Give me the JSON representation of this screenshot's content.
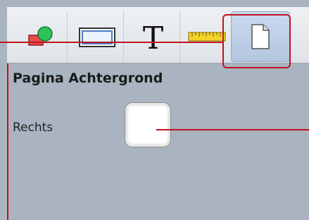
{
  "toolbar": {
    "buttons": [
      {
        "name": "shapes",
        "icon": "shapes-icon"
      },
      {
        "name": "rectangle",
        "icon": "rectangle-icon"
      },
      {
        "name": "text",
        "icon": "text-icon",
        "glyph": "T"
      },
      {
        "name": "ruler",
        "icon": "ruler-icon"
      },
      {
        "name": "page",
        "icon": "page-icon",
        "selected": true
      }
    ]
  },
  "panel": {
    "title": "Pagina Achtergrond",
    "rows": [
      {
        "label": "Rechts",
        "swatch_color": "#ffffff"
      }
    ]
  },
  "colors": {
    "callout": "#c1121f",
    "background": "#a9b4c0",
    "selected_tab": "#b4c7e0"
  }
}
